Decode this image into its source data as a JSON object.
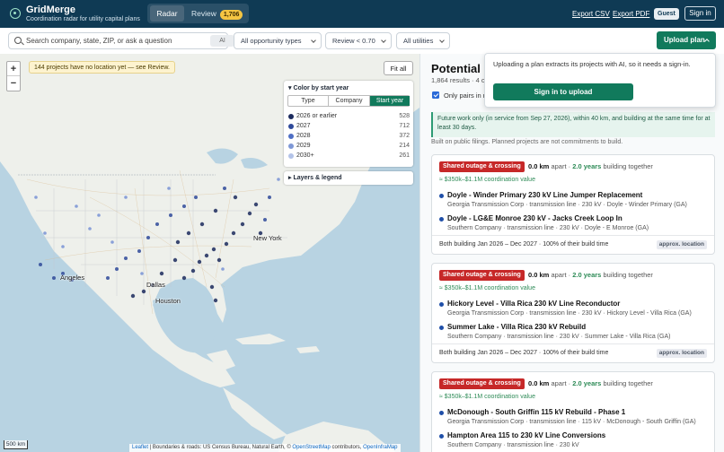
{
  "app": {
    "name": "GridMerge",
    "tagline": "Coordination radar for utility capital plans"
  },
  "tabs": {
    "radar": "Radar",
    "review": "Review",
    "review_count": "1,706"
  },
  "header": {
    "export_csv": "Export CSV",
    "export_pdf": "Export PDF",
    "guest": "Guest",
    "sign_in": "Sign in"
  },
  "filters": {
    "search_placeholder": "Search company, state, ZIP, or ask a question",
    "ai_label": "AI",
    "opportunity": "All opportunity types",
    "review": "Review < 0.70",
    "utilities": "All utilities",
    "upload": "Upload plan"
  },
  "popover": {
    "text": "Uploading a plan extracts its projects with AI, so it needs a sign-in.",
    "button": "Sign in to upload"
  },
  "map": {
    "no_location_notice": "144 projects have no location yet — see Review.",
    "fit_all": "Fit all",
    "zoom_in": "+",
    "zoom_out": "−",
    "legend": {
      "title": "▾ Color by start year",
      "segments": [
        "Type",
        "Company",
        "Start year"
      ],
      "rows": [
        {
          "label": "2026 or earlier",
          "count": "528",
          "color": "#1c2b5e"
        },
        {
          "label": "2027",
          "count": "712",
          "color": "#2f4a9a"
        },
        {
          "label": "2028",
          "count": "372",
          "color": "#4f6fc4"
        },
        {
          "label": "2029",
          "count": "214",
          "color": "#7f98d6"
        },
        {
          "label": "2030+",
          "count": "261",
          "color": "#b3c3e8"
        }
      ]
    },
    "layers": "▸ Layers & legend",
    "scale": "500 km",
    "attribution": {
      "leaflet": "Leaflet",
      "sep1": " | Boundaries & roads: US Census Bureau, Natural Earth, © ",
      "osm": "OpenStreetMap",
      "sep2": " contributors, ",
      "oim": "OpenInfraMap"
    },
    "cities": [
      "New York",
      "Angeles",
      "Dallas",
      "Houston"
    ]
  },
  "panel": {
    "title": "Potential co",
    "meta": "1,864 results · 4 o",
    "only_pairs": "Only pairs in m",
    "info": "Future work only (in service from Sep 27, 2026), within 40 km, and building at the same time for at least 30 days.",
    "disclaimer": "Built on public filings. Planned projects are not commitments to build.",
    "cards": [
      {
        "tag": "Shared outage & crossing",
        "distance": "0.0 km",
        "apart": "apart ·",
        "years": "2.0 years",
        "together": "building together",
        "value": "≈ $350k–$1.1M coordination value",
        "projects": [
          {
            "name": "Doyle - Winder Primary 230 kV Line Jumper Replacement",
            "meta": "Georgia Transmission Corp · transmission line · 230 kV · Doyle - Winder Primary (GA)"
          },
          {
            "name": "Doyle - LG&E Monroe 230 kV - Jacks Creek Loop In",
            "meta": "Southern Company · transmission line · 230 kV · Doyle - E Monroe (GA)"
          }
        ],
        "footer": "Both building Jan 2026 – Dec 2027 · 100% of their build time",
        "badge": "approx. location"
      },
      {
        "tag": "Shared outage & crossing",
        "distance": "0.0 km",
        "apart": "apart ·",
        "years": "2.0 years",
        "together": "building together",
        "value": "≈ $350k–$1.1M coordination value",
        "projects": [
          {
            "name": "Hickory Level - Villa Rica 230 kV Line Reconductor",
            "meta": "Georgia Transmission Corp · transmission line · 230 kV · Hickory Level - Villa Rica (GA)"
          },
          {
            "name": "Summer Lake - Villa Rica 230 kV Rebuild",
            "meta": "Southern Company · transmission line · 230 kV · Summer Lake - Villa Rica (GA)"
          }
        ],
        "footer": "Both building Jan 2026 – Dec 2027 · 100% of their build time",
        "badge": "approx. location"
      },
      {
        "tag": "Shared outage & crossing",
        "distance": "0.0 km",
        "apart": "apart ·",
        "years": "2.0 years",
        "together": "building together",
        "value": "≈ $350k–$1.1M coordination value",
        "projects": [
          {
            "name": "McDonough - South Griffin 115 kV Rebuild - Phase 1",
            "meta": "Georgia Transmission Corp · transmission line · 115 kV · McDonough - South Griffin (GA)"
          },
          {
            "name": "Hampton Area 115 to 230 kV Line Conversions",
            "meta": "Southern Company · transmission line · 230 kV"
          }
        ],
        "footer": "",
        "badge": ""
      }
    ]
  }
}
